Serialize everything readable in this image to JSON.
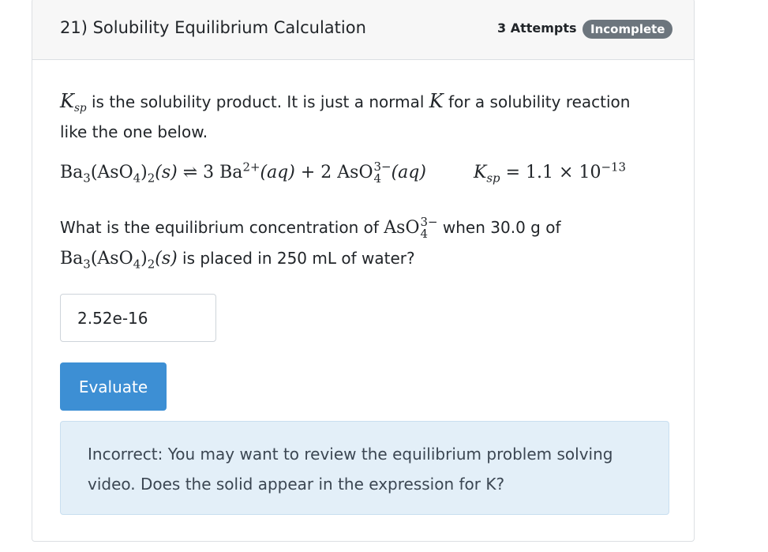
{
  "header": {
    "title": "21) Solubility Equilibrium Calculation",
    "attempts": "3 Attempts",
    "status": "Incomplete"
  },
  "intro": {
    "symbol_main": "K",
    "symbol_sub": "sp",
    "text_1": " is the solubility product. It is just a normal ",
    "symbol_k": "K",
    "text_2": " for a solubility reaction like the one below."
  },
  "equation": {
    "reactant": "Ba",
    "reactant_sub1": "3",
    "reactant_group": "(AsO",
    "reactant_sub2": "4",
    "reactant_close": ")",
    "reactant_sub3": "2",
    "reactant_state": "(s)",
    "arrow": "⇌",
    "product1_coef": "3",
    "product1": "Ba",
    "product1_charge": "2+",
    "product1_state": "(aq)",
    "plus": "+",
    "product2_coef": "2",
    "product2": "AsO",
    "product2_sub": "4",
    "product2_charge": "3−",
    "product2_state": "(aq)",
    "ksp_symbol": "K",
    "ksp_sub": "sp",
    "ksp_equals": "= 1.1 × 10",
    "ksp_exp": "−13"
  },
  "question": {
    "text_1": "What is the equilibrium concentration of ",
    "ion": "AsO",
    "ion_sub": "4",
    "ion_charge": "3−",
    "text_2": " when 30.0 g of ",
    "compound": "Ba",
    "compound_sub1": "3",
    "compound_group": "(AsO",
    "compound_sub2": "4",
    "compound_close": ")",
    "compound_sub3": "2",
    "compound_state": "(s)",
    "text_3": " is placed in 250 mL of water?"
  },
  "answer": {
    "value": "2.52e-16"
  },
  "evaluate_label": "Evaluate",
  "feedback": {
    "text": "Incorrect: You may want to review the equilibrium problem solving video. Does the solid appear in the expression for K?"
  },
  "colors": {
    "header_bg": "#f7f7f7",
    "badge_bg": "#6c757d",
    "button_bg": "#3d8fd4",
    "feedback_bg": "#e3eff8"
  }
}
